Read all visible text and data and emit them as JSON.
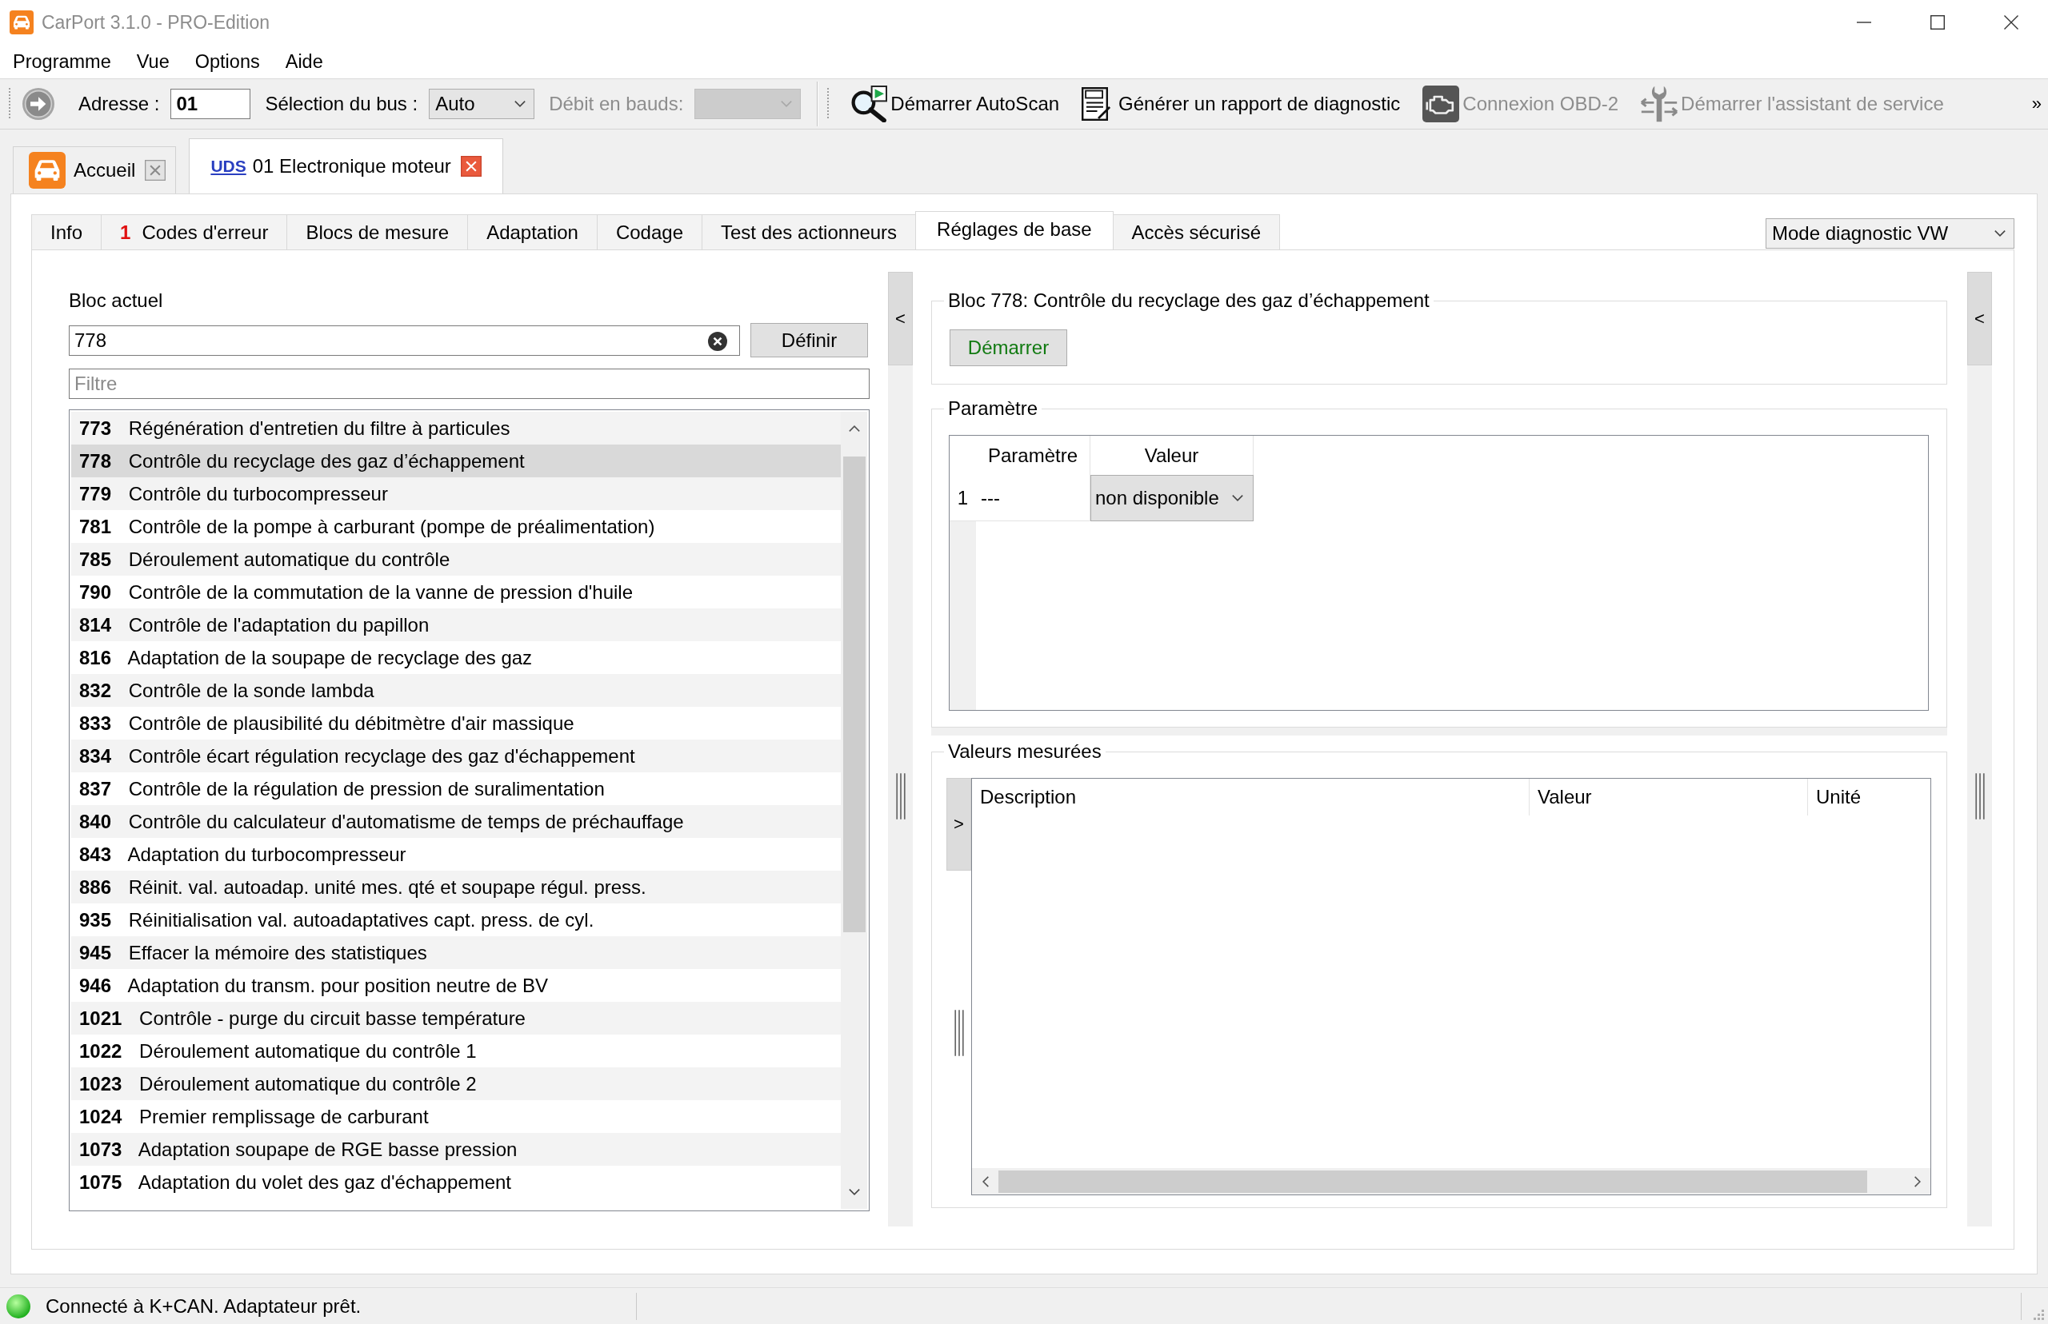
{
  "window": {
    "title": "CarPort 3.1.0 - PRO-Edition"
  },
  "menu": [
    {
      "label": "Programme"
    },
    {
      "label": "Vue"
    },
    {
      "label": "Options"
    },
    {
      "label": "Aide"
    }
  ],
  "toolbar": {
    "address": {
      "label": "Adresse :",
      "value": "01"
    },
    "bus": {
      "label": "Sélection du bus :",
      "value": "Auto"
    },
    "baud": {
      "label": "Débit en bauds:",
      "disabled": true
    },
    "actions": [
      {
        "kind": "autoscan",
        "label": "Démarrer AutoScan",
        "disabled": false
      },
      {
        "kind": "report",
        "label": "Générer un rapport de diagnostic",
        "disabled": false
      },
      {
        "kind": "obd",
        "label": "Connexion OBD-2",
        "disabled": true
      },
      {
        "kind": "service",
        "label": "Démarrer l'assistant de service",
        "disabled": true
      }
    ],
    "overflow": "»"
  },
  "documents": [
    {
      "kind": "home",
      "label": "Accueil",
      "selected": false
    },
    {
      "kind": "module",
      "badge": "UDS",
      "label": "01 Electronique moteur",
      "selected": true
    }
  ],
  "tabs": [
    {
      "label": "Info",
      "selected": false
    },
    {
      "count": "1",
      "label": "Codes d'erreur",
      "selected": false
    },
    {
      "label": "Blocs de mesure",
      "selected": false
    },
    {
      "label": "Adaptation",
      "selected": false
    },
    {
      "label": "Codage",
      "selected": false
    },
    {
      "label": "Test des actionneurs",
      "selected": false
    },
    {
      "label": "Réglages de base",
      "selected": true
    },
    {
      "label": "Accès sécurisé",
      "selected": false
    }
  ],
  "mode_dropdown": {
    "value": "Mode diagnostic VW"
  },
  "block_panel": {
    "label": "Bloc actuel",
    "value": "778",
    "set_button": "Définir",
    "filter": {
      "placeholder": "Filtre"
    },
    "blocks": [
      {
        "number": "773",
        "name": "Régénération d'entretien du filtre à particules",
        "selected": false
      },
      {
        "number": "778",
        "name": "Contrôle du recyclage des gaz d’échappement",
        "selected": true
      },
      {
        "number": "779",
        "name": "Contrôle du turbocompresseur",
        "selected": false
      },
      {
        "number": "781",
        "name": "Contrôle de la pompe à carburant (pompe de préalimentation)",
        "selected": false
      },
      {
        "number": "785",
        "name": "Déroulement automatique du contrôle",
        "selected": false
      },
      {
        "number": "790",
        "name": "Contrôle de la commutation de la vanne de pression d'huile",
        "selected": false
      },
      {
        "number": "814",
        "name": "Contrôle de l'adaptation du papillon",
        "selected": false
      },
      {
        "number": "816",
        "name": "Adaptation de la soupape de recyclage des gaz",
        "selected": false
      },
      {
        "number": "832",
        "name": "Contrôle de la sonde lambda",
        "selected": false
      },
      {
        "number": "833",
        "name": "Contrôle de plausibilité du débitmètre d'air massique",
        "selected": false
      },
      {
        "number": "834",
        "name": "Contrôle écart régulation recyclage des gaz d'échappement",
        "selected": false
      },
      {
        "number": "837",
        "name": "Contrôle de la régulation de pression de suralimentation",
        "selected": false
      },
      {
        "number": "840",
        "name": "Contrôle du calculateur d'automatisme de temps de préchauffage",
        "selected": false
      },
      {
        "number": "843",
        "name": "Adaptation du turbocompresseur",
        "selected": false
      },
      {
        "number": "886",
        "name": "Réinit. val. autoadap. unité mes. qté et soupape régul. press.",
        "selected": false
      },
      {
        "number": "935",
        "name": "Réinitialisation val. autoadaptatives capt. press. de cyl.",
        "selected": false
      },
      {
        "number": "945",
        "name": "Effacer la mémoire des statistiques",
        "selected": false
      },
      {
        "number": "946",
        "name": "Adaptation du transm. pour position neutre de BV",
        "selected": false
      },
      {
        "number": "1021",
        "name": "Contrôle - purge du circuit basse température",
        "selected": false
      },
      {
        "number": "1022",
        "name": "Déroulement automatique du contrôle 1",
        "selected": false
      },
      {
        "number": "1023",
        "name": "Déroulement automatique du contrôle 2",
        "selected": false
      },
      {
        "number": "1024",
        "name": "Premier remplissage de carburant",
        "selected": false
      },
      {
        "number": "1073",
        "name": "Adaptation soupape de RGE basse pression",
        "selected": false
      },
      {
        "number": "1075",
        "name": "Adaptation du volet des gaz d'échappement",
        "selected": false
      }
    ]
  },
  "left_splitter": {
    "toggle": "<"
  },
  "block_group": {
    "title": "Bloc 778: Contrôle du recyclage des gaz d’échappement",
    "start_button": "Démarrer"
  },
  "parameters": {
    "title": "Paramètre",
    "columns": [
      "Paramètre",
      "Valeur"
    ],
    "rows": [
      {
        "index": "1",
        "parameter": "---",
        "value": "non disponible"
      }
    ]
  },
  "measured": {
    "title": "Valeurs mesurées",
    "toggle": ">",
    "columns": [
      "Description",
      "Valeur",
      "Unité"
    ]
  },
  "right_splitter": {
    "toggle": "<"
  },
  "status_bar": {
    "connected": true,
    "text": "Connecté à K+CAN. Adaptateur prêt."
  }
}
